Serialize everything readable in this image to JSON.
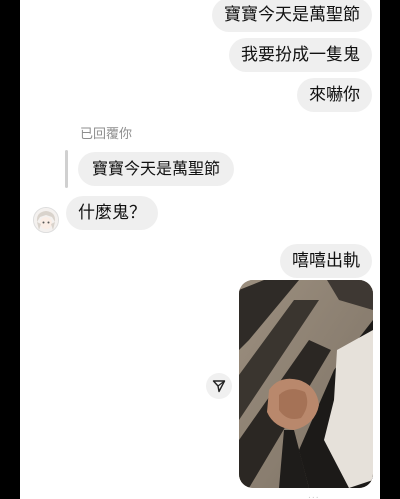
{
  "messages": {
    "sent_1": "寶寶今天是萬聖節",
    "sent_2": "我要扮成一隻鬼",
    "sent_3": "來嚇你",
    "reply_label": "已回覆你",
    "quoted_text": "寶寶今天是萬聖節",
    "received_1": "什麼鬼？",
    "sent_4": "嘻嘻出軌"
  },
  "icons": {
    "share": "paper-plane-icon",
    "avatar": "anime-avatar"
  },
  "colors": {
    "bubble": "#efefef",
    "background": "#ffffff",
    "reply_label": "#8e8e8e"
  }
}
